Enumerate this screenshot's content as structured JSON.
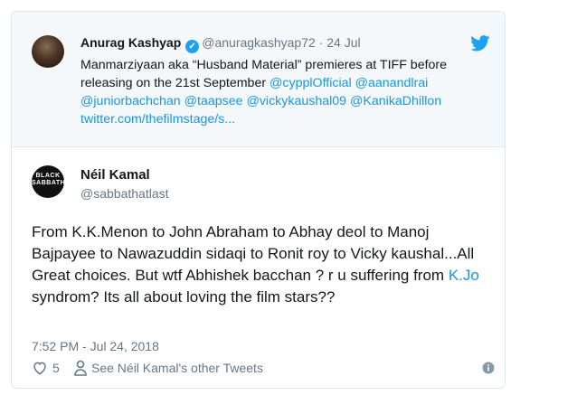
{
  "quoted": {
    "name": "Anurag Kashyap",
    "handle": "@anuragkashyap72",
    "separator": "·",
    "date": "24 Jul",
    "text_plain": "Manmarziyaan aka “Husband Material” premieres at TIFF before releasing on the 21st September",
    "mentions": [
      "@cypplOfficial",
      "@aanandlrai",
      "@juniorbachchan",
      "@taapsee",
      "@vickykaushal09",
      "@KanikaDhillon"
    ],
    "link": "twitter.com/thefilmstage/s..."
  },
  "tweet": {
    "avatar_text": "BLACK SABBATH",
    "name": "Néil Kamal",
    "handle": "@sabbathatlast",
    "text_before": "From K.K.Menon to John Abraham to Abhay deol to Manoj Bajpayee to Nawazuddin sidaqi to Ronit roy to Vicky kaushal...All Great choices. But wtf Abhishek bacchan ? r u suffering from ",
    "text_link": "K.Jo",
    "text_after": " syndrom? Its all about loving the film stars??",
    "timestamp": "7:52 PM - Jul 24, 2018"
  },
  "actions": {
    "like_count": "5",
    "other_tweets_label": "See Néil Kamal's other Tweets"
  },
  "colors": {
    "twitter_blue": "#1da1f2",
    "link": "#1b95e0",
    "secondary_text": "#657786",
    "quoted_background": "#f5f8fa"
  }
}
